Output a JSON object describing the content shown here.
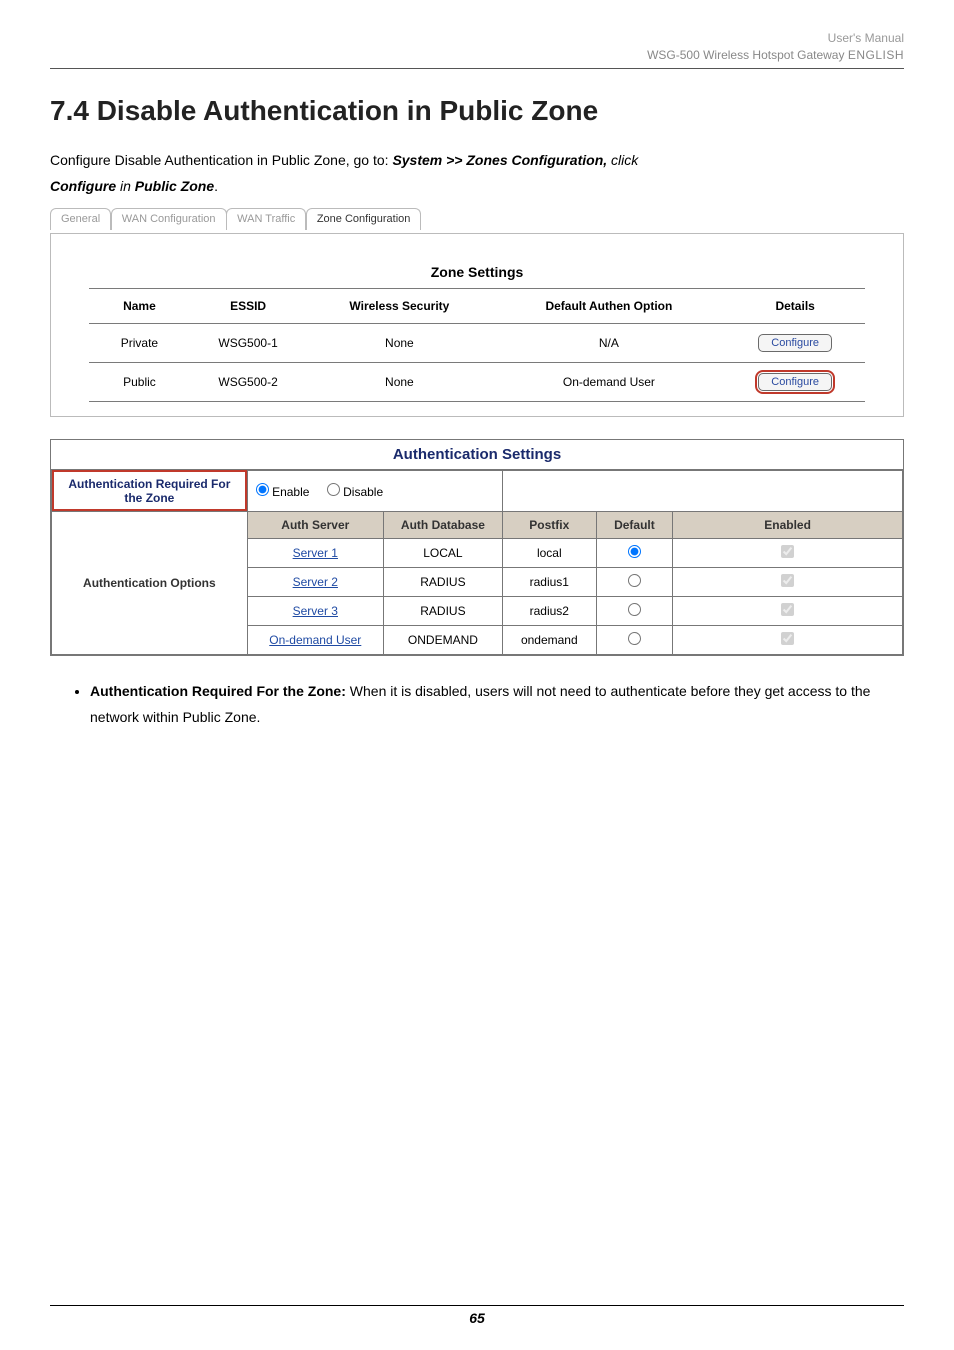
{
  "header": {
    "line1": "User's Manual",
    "line2_prefix": "WSG-500 Wireless Hotspot Gateway ",
    "line2_lang": "ENGLISH"
  },
  "section": {
    "title": "7.4  Disable Authentication in Public Zone",
    "intro_pre": "Configure Disable Authentication in Public Zone, go to: ",
    "intro_path": "System >> Zones Configuration, ",
    "intro_click": "click ",
    "intro_conf": "Configure",
    "intro_in": " in ",
    "intro_pub": "Public Zone",
    "intro_dot": "."
  },
  "tabs": [
    "General",
    "WAN Configuration",
    "WAN Traffic",
    "Zone Configuration"
  ],
  "zone_table": {
    "caption": "Zone Settings",
    "headers": [
      "Name",
      "ESSID",
      "Wireless Security",
      "Default Authen Option",
      "Details"
    ],
    "rows": [
      {
        "name": "Private",
        "essid": "WSG500-1",
        "sec": "None",
        "auth": "N/A",
        "btn": "Configure",
        "hl": false
      },
      {
        "name": "Public",
        "essid": "WSG500-2",
        "sec": "None",
        "auth": "On-demand User",
        "btn": "Configure",
        "hl": true
      }
    ]
  },
  "auth": {
    "title": "Authentication Settings",
    "req_label": "Authentication Required For the Zone",
    "enable_label": "Enable",
    "disable_label": "Disable",
    "opts_label": "Authentication Options",
    "headers": [
      "Auth Server",
      "Auth Database",
      "Postfix",
      "Default",
      "Enabled"
    ],
    "rows": [
      {
        "server": "Server 1",
        "db": "LOCAL",
        "postfix": "local",
        "default": true,
        "enabled": true
      },
      {
        "server": "Server 2",
        "db": "RADIUS",
        "postfix": "radius1",
        "default": false,
        "enabled": true
      },
      {
        "server": "Server 3",
        "db": "RADIUS",
        "postfix": "radius2",
        "default": false,
        "enabled": true
      },
      {
        "server": "On-demand User",
        "db": "ONDEMAND",
        "postfix": "ondemand",
        "default": false,
        "enabled": true
      }
    ]
  },
  "bullet": {
    "lead": "Authentication Required For the Zone: ",
    "rest": "When it is disabled, users will not need to authenticate before they get access to the network within Public Zone."
  },
  "footer": {
    "page": "65"
  }
}
